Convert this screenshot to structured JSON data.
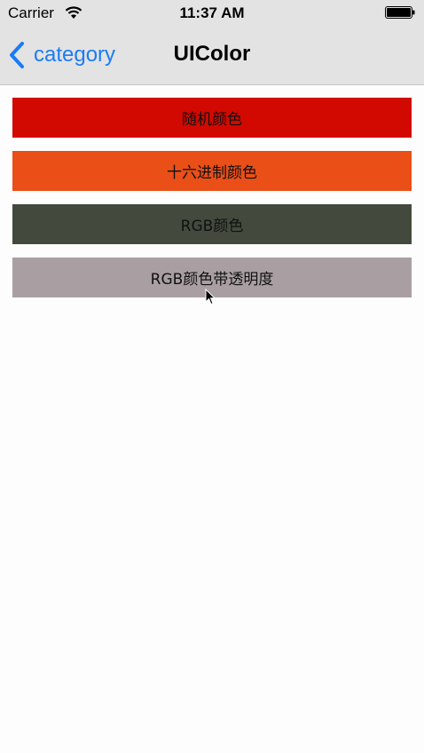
{
  "status_bar": {
    "carrier": "Carrier",
    "time": "11:37 AM",
    "icons": [
      "wifi-icon",
      "battery-icon"
    ]
  },
  "nav_bar": {
    "back_label": "category",
    "back_icon": "chevron-left-icon",
    "title": "UIColor",
    "accent_color": "#1a7cf5"
  },
  "buttons": [
    {
      "label": "随机颜色",
      "color": "#d20900"
    },
    {
      "label": "十六进制颜色",
      "color": "#ea4f18"
    },
    {
      "label": "RGB颜色",
      "color": "#434a3d"
    },
    {
      "label": "RGB颜色带透明度",
      "color": "#a99fa3"
    }
  ]
}
